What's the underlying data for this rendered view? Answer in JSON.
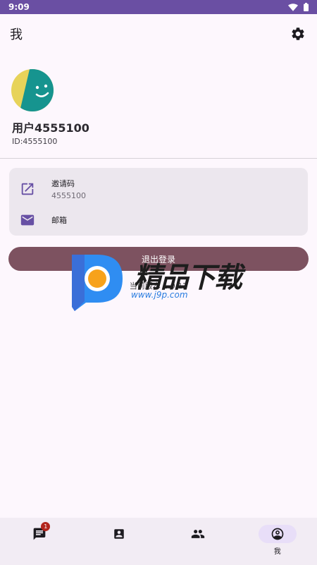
{
  "status_bar": {
    "time": "9:09"
  },
  "header": {
    "title": "我"
  },
  "profile": {
    "username": "用户4555100",
    "user_id": "ID:4555100"
  },
  "menu": {
    "items": [
      {
        "title": "邀请码",
        "subtitle": "4555100",
        "icon": "open-in-new-icon"
      },
      {
        "title": "邮箱",
        "icon": "mail-icon"
      }
    ]
  },
  "logout": {
    "label": "退出登录"
  },
  "version": {
    "text": "当前版本 1.0.12"
  },
  "watermark": {
    "text": "精品下载",
    "url": "www.j9p.com"
  },
  "bottom_nav": {
    "items": [
      {
        "icon": "chat-icon",
        "label": "",
        "badge": "1"
      },
      {
        "icon": "contact-card-icon",
        "label": ""
      },
      {
        "icon": "group-icon",
        "label": ""
      },
      {
        "icon": "account-circle-icon",
        "label": "我",
        "active": true
      }
    ]
  },
  "colors": {
    "status_bar": "#6a4fa3",
    "accent": "#6750a4",
    "logout_button": "#7d5260",
    "background": "#fdf7fd",
    "card": "#ece7ee",
    "nav_bar": "#f2ecf4",
    "nav_active_pill": "#e8def8",
    "badge": "#b3261e"
  }
}
